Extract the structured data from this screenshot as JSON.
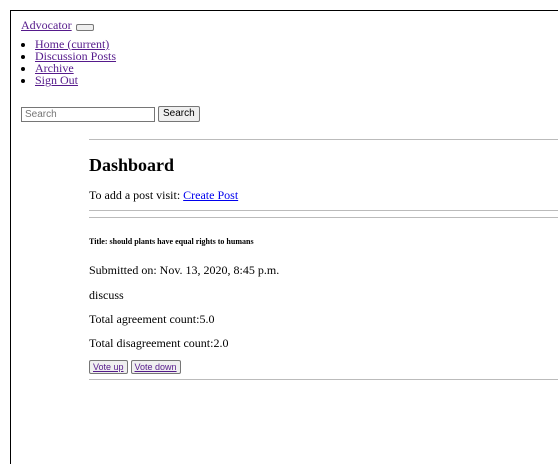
{
  "nav": {
    "brand": "Advocator",
    "items": [
      {
        "label": "Home (current)"
      },
      {
        "label": "Discussion Posts"
      },
      {
        "label": "Archive"
      },
      {
        "label": "Sign Out"
      }
    ]
  },
  "search": {
    "placeholder": "Search",
    "button_label": "Search"
  },
  "dashboard": {
    "heading": "Dashboard",
    "add_post_prefix": "To add a post visit: ",
    "create_post_link": "Create Post"
  },
  "post": {
    "title": "Title: should plants have equal rights to humans",
    "submitted": "Submitted on: Nov. 13, 2020, 8:45 p.m.",
    "body": "discuss",
    "agreement": "Total agreement count:5.0",
    "disagreement": "Total disagreement count:2.0",
    "vote_up_label": "Vote up",
    "vote_down_label": "Vote down"
  }
}
